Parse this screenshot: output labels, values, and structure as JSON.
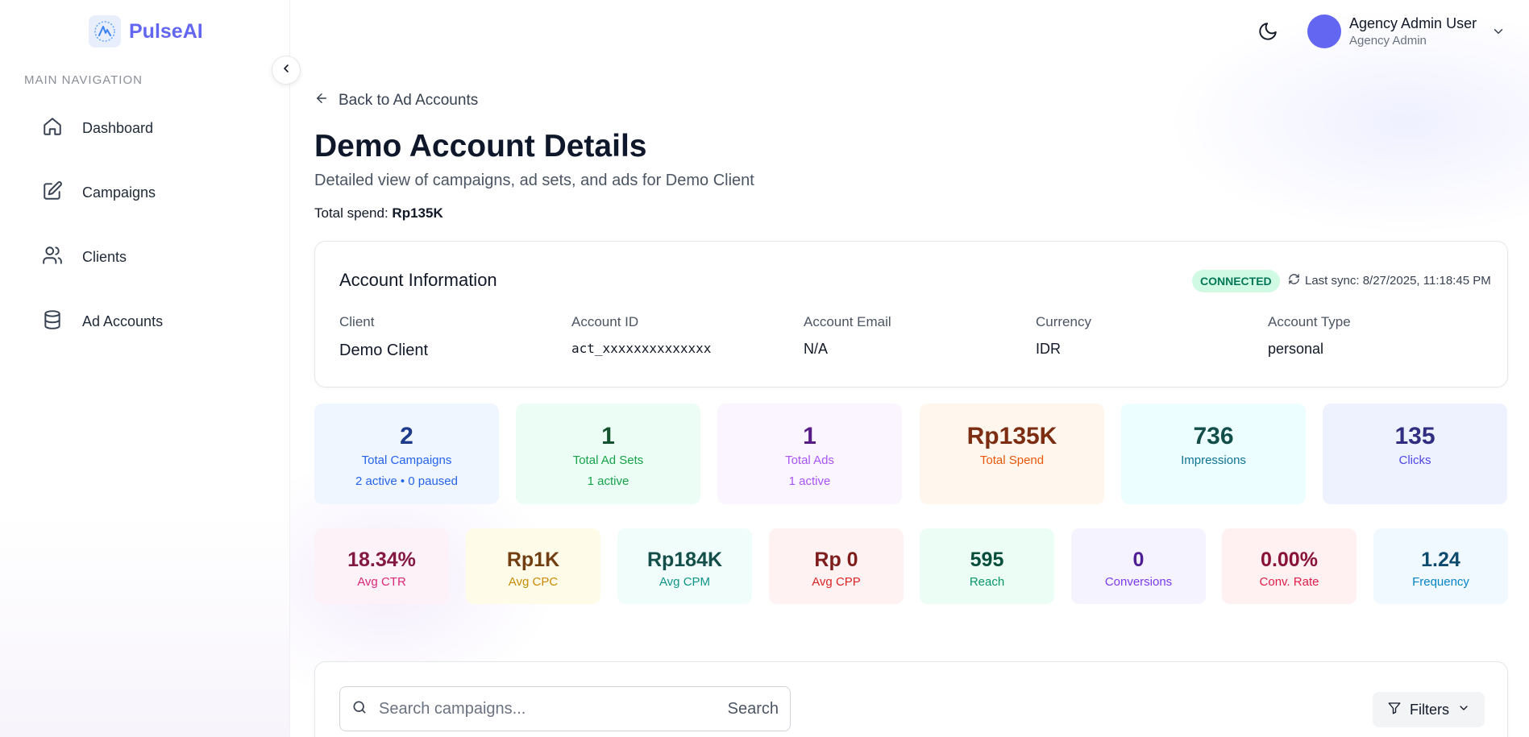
{
  "brand": {
    "name": "PulseAI"
  },
  "sidebar": {
    "heading": "MAIN NAVIGATION",
    "items": [
      {
        "label": "Dashboard",
        "icon": "home-icon"
      },
      {
        "label": "Campaigns",
        "icon": "edit-icon"
      },
      {
        "label": "Clients",
        "icon": "users-icon"
      },
      {
        "label": "Ad Accounts",
        "icon": "database-icon"
      }
    ]
  },
  "header": {
    "user_name": "Agency Admin User",
    "user_role": "Agency Admin",
    "avatar_color": "#6366f1"
  },
  "page": {
    "back_label": "Back to Ad Accounts",
    "title": "Demo Account Details",
    "subtitle": "Detailed view of campaigns, ad sets, and ads for Demo Client",
    "total_spend_label": "Total spend:",
    "total_spend_value": "Rp135K"
  },
  "account_info": {
    "title": "Account Information",
    "status": "CONNECTED",
    "last_sync": "Last sync: 8/27/2025, 11:18:45 PM",
    "fields": [
      {
        "label": "Client",
        "value": "Demo Client"
      },
      {
        "label": "Account ID",
        "value": "act_xxxxxxxxxxxxxx"
      },
      {
        "label": "Account Email",
        "value": "N/A"
      },
      {
        "label": "Currency",
        "value": "IDR"
      },
      {
        "label": "Account Type",
        "value": "personal"
      }
    ]
  },
  "stats_primary": [
    {
      "value": "2",
      "label": "Total Campaigns",
      "sub": "2 active • 0 paused",
      "bg": "#eff6ff",
      "value_color": "#1e3a8a",
      "label_color": "#2563eb"
    },
    {
      "value": "1",
      "label": "Total Ad Sets",
      "sub": "1 active",
      "bg": "#ecfdf5",
      "value_color": "#14532d",
      "label_color": "#16a34a"
    },
    {
      "value": "1",
      "label": "Total Ads",
      "sub": "1 active",
      "bg": "#faf5ff",
      "value_color": "#581c87",
      "label_color": "#a855f7"
    },
    {
      "value": "Rp135K",
      "label": "Total Spend",
      "sub": "",
      "bg": "#fff7ed",
      "value_color": "#7c2d12",
      "label_color": "#ea580c"
    },
    {
      "value": "736",
      "label": "Impressions",
      "sub": "",
      "bg": "#ecfeff",
      "value_color": "#134e4a",
      "label_color": "#0e7490"
    },
    {
      "value": "135",
      "label": "Clicks",
      "sub": "",
      "bg": "#eef2ff",
      "value_color": "#312e81",
      "label_color": "#4f46e5"
    }
  ],
  "stats_secondary": [
    {
      "value": "18.34%",
      "label": "Avg CTR",
      "bg": "#fdf2f8",
      "value_color": "#831843",
      "label_color": "#db2777"
    },
    {
      "value": "Rp1K",
      "label": "Avg CPC",
      "bg": "#fefce8",
      "value_color": "#713f12",
      "label_color": "#ca8a04"
    },
    {
      "value": "Rp184K",
      "label": "Avg CPM",
      "bg": "#f0fdfa",
      "value_color": "#134e4a",
      "label_color": "#0d9488"
    },
    {
      "value": "Rp 0",
      "label": "Avg CPP",
      "bg": "#fef2f2",
      "value_color": "#7f1d1d",
      "label_color": "#dc2626"
    },
    {
      "value": "595",
      "label": "Reach",
      "bg": "#ecfdf5",
      "value_color": "#064e3b",
      "label_color": "#059669"
    },
    {
      "value": "0",
      "label": "Conversions",
      "bg": "#f5f3ff",
      "value_color": "#4c1d95",
      "label_color": "#7c3aed"
    },
    {
      "value": "0.00%",
      "label": "Conv. Rate",
      "bg": "#fff1f2",
      "value_color": "#881337",
      "label_color": "#e11d48"
    },
    {
      "value": "1.24",
      "label": "Frequency",
      "bg": "#f0f9ff",
      "value_color": "#0c4a6e",
      "label_color": "#0284c7"
    }
  ],
  "search": {
    "placeholder": "Search campaigns...",
    "button_label": "Search",
    "filters_label": "Filters"
  }
}
